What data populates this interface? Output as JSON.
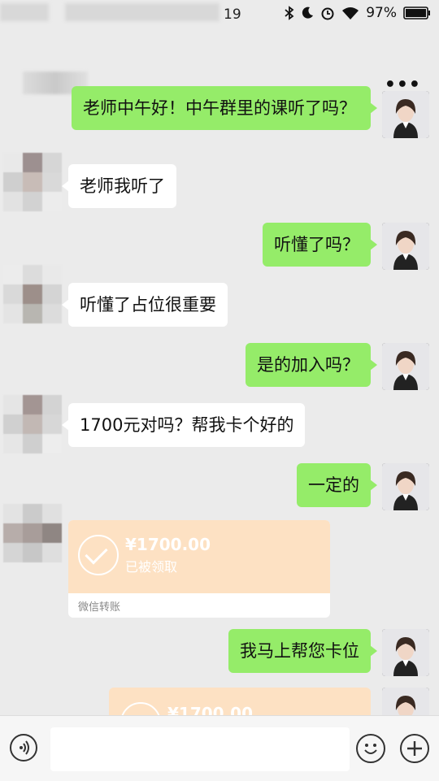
{
  "status_bar": {
    "time": "19",
    "battery": "97%"
  },
  "navbar": {
    "more_label": "•••"
  },
  "messages": [
    {
      "side": "out",
      "text": "老师中午好！中午群里的课听了吗？"
    },
    {
      "side": "in",
      "text": "老师我听了"
    },
    {
      "side": "out",
      "text": "听懂了吗？"
    },
    {
      "side": "in",
      "text": "听懂了占位很重要"
    },
    {
      "side": "out",
      "text": "是的加入吗？"
    },
    {
      "side": "in",
      "text": "1700元对吗？帮我卡个好的"
    },
    {
      "side": "out",
      "text": "一定的"
    },
    {
      "side": "in",
      "type": "transfer",
      "amount": "¥1700.00",
      "status": "已被领取",
      "footer": "微信转账"
    },
    {
      "side": "out",
      "text": "我马上帮您卡位"
    },
    {
      "side": "out",
      "type": "transfer_partial",
      "amount": "¥1700.00"
    }
  ],
  "colors": {
    "bg": "#ebebeb",
    "out_bubble": "#95ec69",
    "in_bubble": "#ffffff",
    "transfer": "#fde1c3"
  }
}
